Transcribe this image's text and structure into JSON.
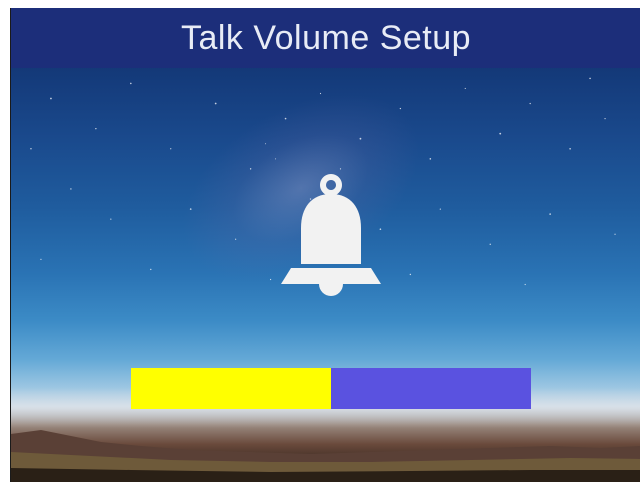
{
  "header": {
    "title": "Talk Volume Setup"
  },
  "volume": {
    "level": 0.5,
    "fill_color": "#ffff00",
    "track_color": "#5a52e0"
  },
  "icon": {
    "name": "bell-icon"
  },
  "colors": {
    "title_bar": "#1c2e7a",
    "title_text": "#e8ecf6"
  }
}
